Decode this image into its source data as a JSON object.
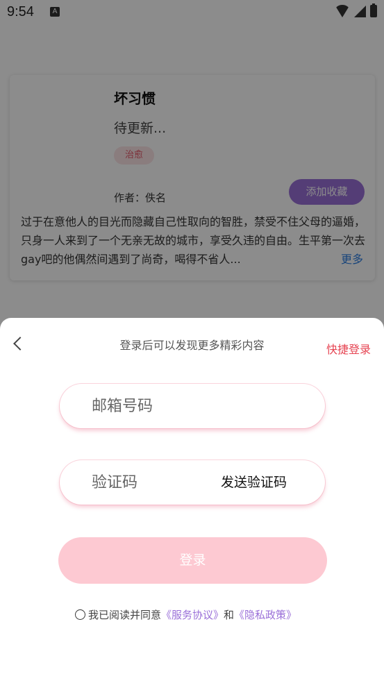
{
  "status_bar": {
    "time": "9:54",
    "notif": "A"
  },
  "book": {
    "title": "坏习惯",
    "status": "待更新...",
    "tag": "治愈",
    "author": "作者：佚名",
    "favorite_label": "添加收藏",
    "description": "过于在意他人的目光而隐藏自己性取向的智胜，禁受不住父母的逼婚，只身一人来到了一个无亲无故的城市，享受久违的自由。生平第一次去gay吧的他偶然间遇到了尚奇，喝得不省人...",
    "more_label": "更多"
  },
  "login_sheet": {
    "title": "登录后可以发现更多精彩内容",
    "quick_login": "快捷登录",
    "email_placeholder": "邮箱号码",
    "code_placeholder": "验证码",
    "send_code": "发送验证码",
    "login_label": "登录",
    "agree_prefix": "我已阅读并同意",
    "service_link": "《服务协议》",
    "and_text": "和",
    "privacy_link": "《隐私政策》"
  },
  "colors": {
    "accent_purple": "#9a6fd8",
    "quick_login_red": "#e64452",
    "login_btn_pink": "#fdc9d2"
  }
}
